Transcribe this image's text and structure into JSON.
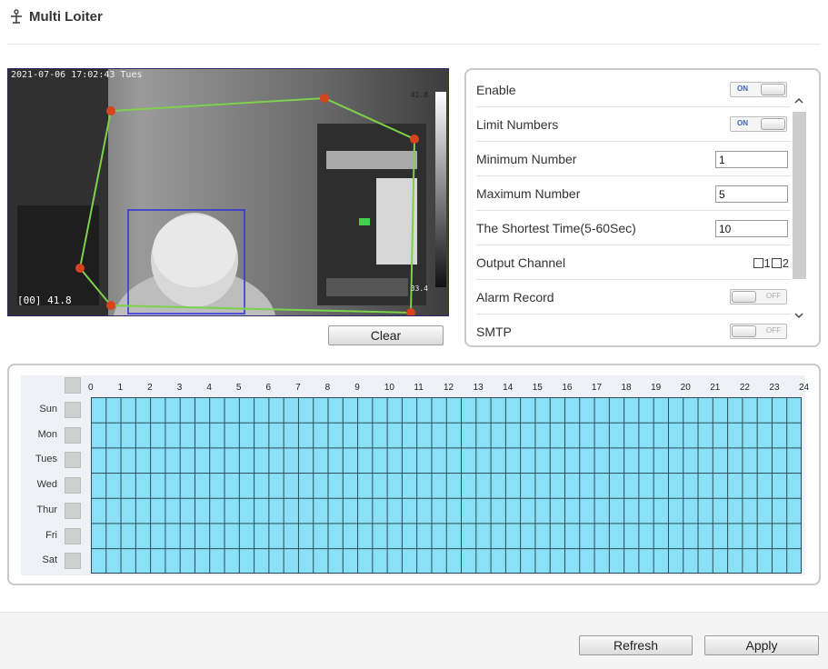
{
  "header": {
    "title": "Multi Loiter",
    "icon": "loiter-icon"
  },
  "video": {
    "timestamp": "2021-07-06 17:02:43 Tues",
    "overlay_text": "[00] 41.8",
    "scale_top": "41.8",
    "scale_bottom": "33.4",
    "colors": {
      "polygon": "#7ed14a",
      "vertex": "#d8431e",
      "box": "#2f2fe0"
    }
  },
  "buttons": {
    "clear": "Clear",
    "refresh": "Refresh",
    "apply": "Apply"
  },
  "settings": {
    "enable": {
      "label": "Enable",
      "state": "ON"
    },
    "limit_numbers": {
      "label": "Limit Numbers",
      "state": "ON"
    },
    "minimum_number": {
      "label": "Minimum Number",
      "value": "1"
    },
    "maximum_number": {
      "label": "Maximum Number",
      "value": "5"
    },
    "shortest_time": {
      "label": "The Shortest Time(5-60Sec)",
      "value": "10"
    },
    "output_channel": {
      "label": "Output Channel",
      "options": [
        "1",
        "2"
      ]
    },
    "alarm_record": {
      "label": "Alarm Record",
      "state": "OFF"
    },
    "smtp": {
      "label": "SMTP",
      "state": "OFF"
    }
  },
  "schedule": {
    "hours": [
      "0",
      "1",
      "2",
      "3",
      "4",
      "5",
      "6",
      "7",
      "8",
      "9",
      "10",
      "11",
      "12",
      "13",
      "14",
      "15",
      "16",
      "17",
      "18",
      "19",
      "20",
      "21",
      "22",
      "23",
      "24"
    ],
    "days": [
      "Sun",
      "Mon",
      "Tues",
      "Wed",
      "Thur",
      "Fri",
      "Sat"
    ],
    "cell_color": "#8ae0f6"
  }
}
